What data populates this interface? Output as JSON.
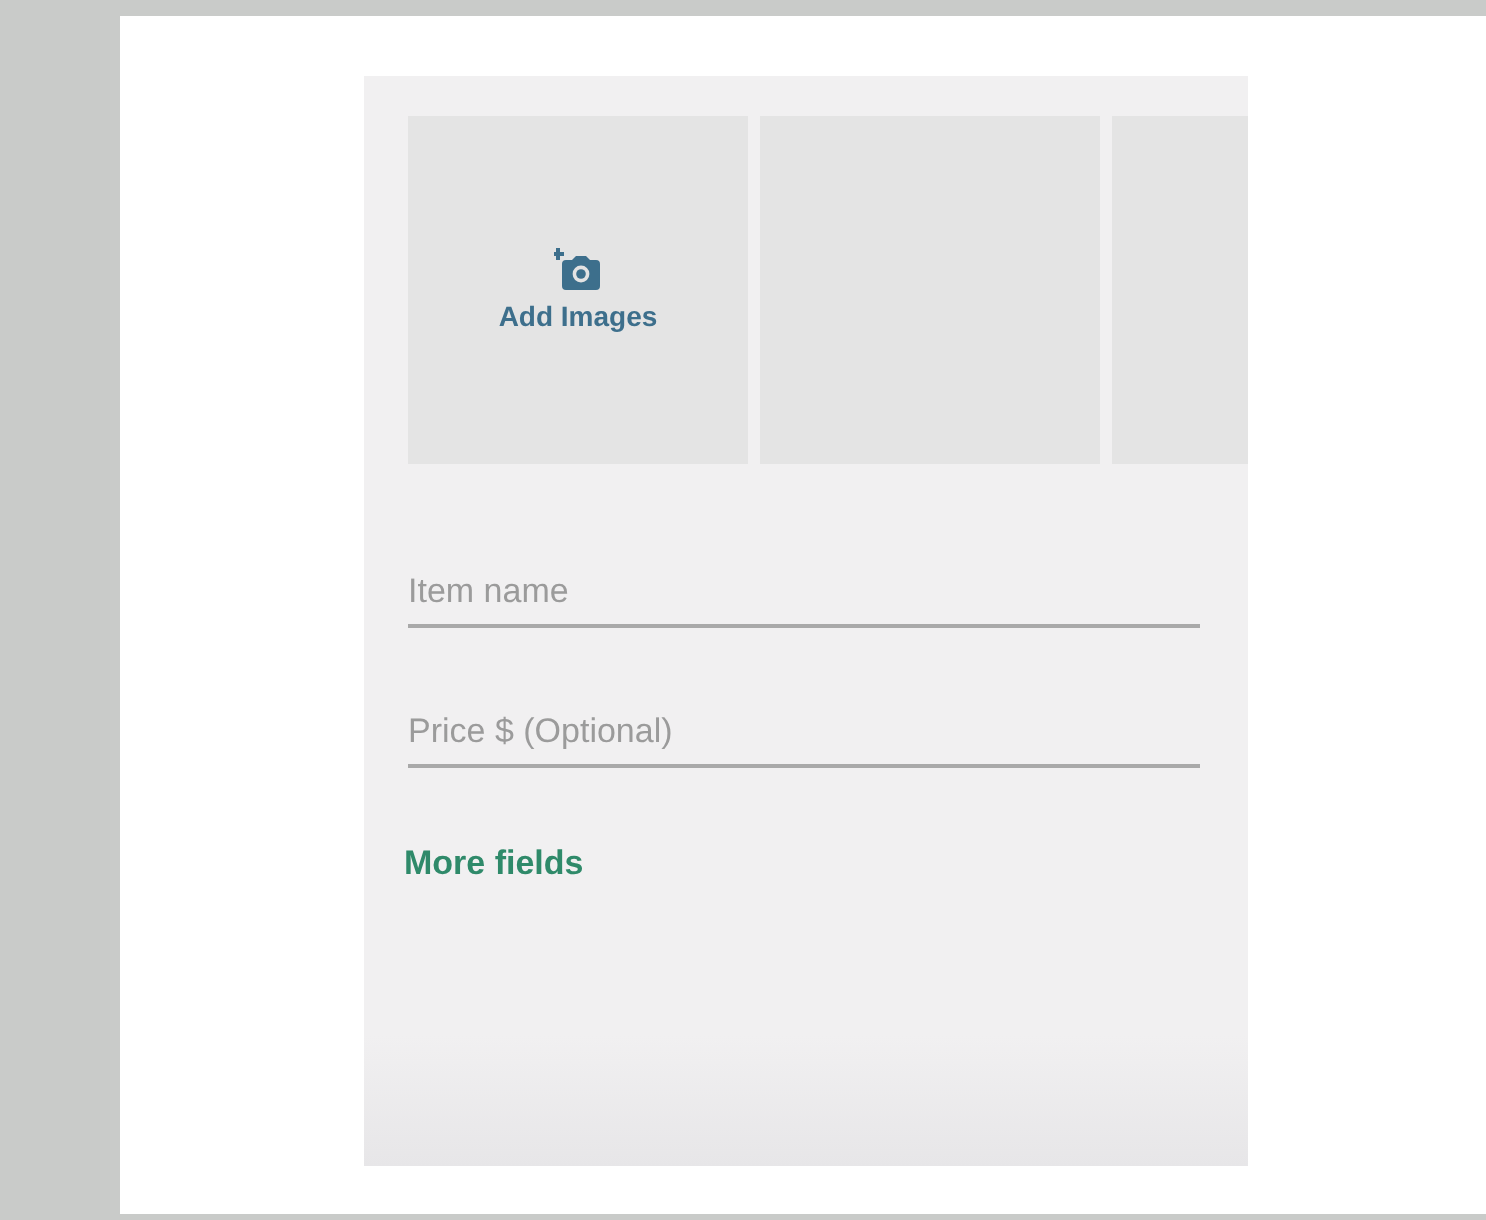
{
  "image_slots": [
    {
      "kind": "add",
      "label": "Add Images"
    },
    {
      "kind": "empty"
    },
    {
      "kind": "empty"
    }
  ],
  "fields": [
    {
      "placeholder": "Item name"
    },
    {
      "placeholder": "Price $ (Optional)"
    }
  ],
  "more_link": "More fields"
}
